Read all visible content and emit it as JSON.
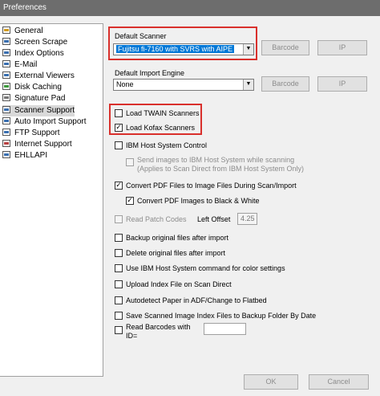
{
  "window": {
    "title": "Preferences"
  },
  "tree": {
    "items": [
      {
        "label": "General",
        "icon": "star"
      },
      {
        "label": "Screen Scrape",
        "icon": ""
      },
      {
        "label": "Index Options",
        "icon": ""
      },
      {
        "label": "E-Mail",
        "icon": ""
      },
      {
        "label": "External Viewers",
        "icon": ""
      },
      {
        "label": "Disk Caching",
        "icon": "green"
      },
      {
        "label": "Signature Pad",
        "icon": "grey"
      },
      {
        "label": "Scanner Support",
        "icon": ""
      },
      {
        "label": "Auto Import Support",
        "icon": ""
      },
      {
        "label": "FTP Support",
        "icon": ""
      },
      {
        "label": "Internet Support",
        "icon": "red"
      },
      {
        "label": "EHLLAPI",
        "icon": ""
      }
    ],
    "selected": "Scanner Support"
  },
  "scanner": {
    "default_scanner_label": "Default Scanner",
    "default_scanner_value": "Fujitsu fi-7160 with SVRS with AIPE",
    "barcode_label": "Barcode",
    "ip_label": "IP",
    "import_engine_label": "Default Import Engine",
    "import_engine_value": "None",
    "barcode2_label": "Barcode",
    "ip2_label": "IP"
  },
  "options": {
    "load_twain": {
      "label": "Load TWAIN Scanners",
      "checked": false
    },
    "load_kofax": {
      "label": "Load Kofax Scanners",
      "checked": true
    },
    "ibm_host": {
      "label": "IBM Host System Control",
      "checked": false
    },
    "send_images": {
      "label_line1": "Send images to IBM Host System while scanning",
      "label_line2": "(Applies to Scan Direct from IBM Host System Only)",
      "checked": false
    },
    "convert_pdf": {
      "label": "Convert PDF Files to Image Files During Scan/Import",
      "checked": true
    },
    "convert_pdf_bw": {
      "label": "Convert PDF Images to Black & White",
      "checked": true
    },
    "read_patch": {
      "label": "Read Patch Codes",
      "checked": false
    },
    "left_offset_label": "Left Offset",
    "left_offset_value": "4.25",
    "backup": {
      "label": "Backup original files after import",
      "checked": false
    },
    "delete": {
      "label": "Delete original files after import",
      "checked": false
    },
    "ibm_color": {
      "label": "Use IBM Host System command for color settings",
      "checked": false
    },
    "upload_index": {
      "label": "Upload Index File on Scan Direct",
      "checked": false
    },
    "autodetect": {
      "label": "Autodetect Paper in ADF/Change to Flatbed",
      "checked": false
    },
    "save_index": {
      "label": "Save Scanned Image Index Files to Backup Folder By Date",
      "checked": false
    },
    "read_barcodes": {
      "label_line1": "Read Barcodes with",
      "label_line2": "ID=",
      "checked": false,
      "value": ""
    }
  },
  "footer": {
    "ok_label": "OK",
    "cancel_label": "Cancel"
  },
  "colors": {
    "highlight": "#d9302c",
    "selection": "#0078d7"
  }
}
